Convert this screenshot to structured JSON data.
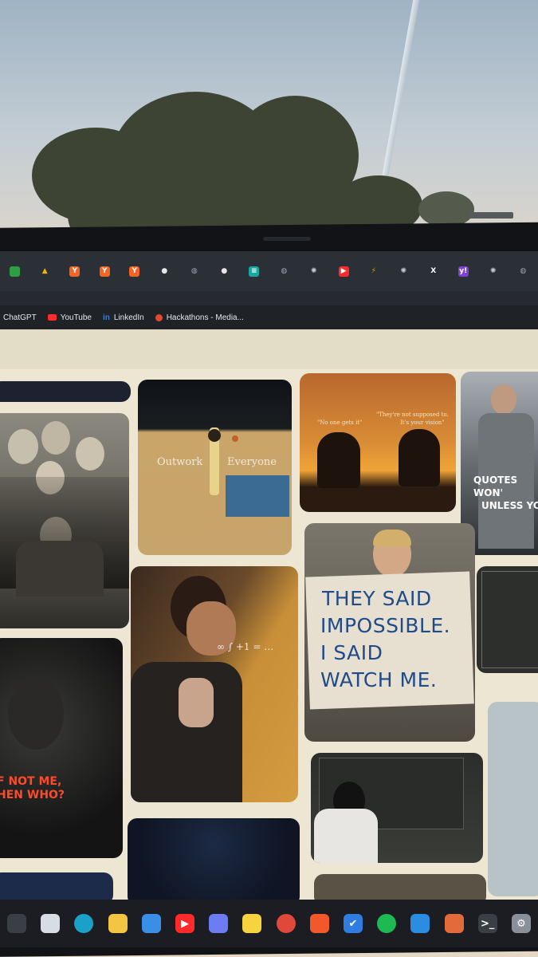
{
  "tabs": [
    {
      "icon": "green-app-icon",
      "label": "",
      "color": "#2ea043"
    },
    {
      "icon": "google-drive-icon",
      "label": "▲",
      "color": "#f4b400"
    },
    {
      "icon": "ycombinator-icon",
      "label": "Y",
      "color": "#f26522"
    },
    {
      "icon": "ycombinator-icon",
      "label": "Y",
      "color": "#f26522"
    },
    {
      "icon": "ycombinator-icon",
      "label": "Y",
      "color": "#f26522"
    },
    {
      "icon": "github-icon",
      "label": "●",
      "color": "#e6e6e6"
    },
    {
      "icon": "globe-icon",
      "label": "◍",
      "color": "#9aa3ad"
    },
    {
      "icon": "github-icon",
      "label": "●",
      "color": "#e6e6e6"
    },
    {
      "icon": "docs-icon",
      "label": "≡",
      "color": "#19a8a0"
    },
    {
      "icon": "globe-icon",
      "label": "◍",
      "color": "#9aa3ad"
    },
    {
      "icon": "openai-icon",
      "label": "✺",
      "color": "#c9ccd0"
    },
    {
      "icon": "youtube-icon",
      "label": "▶",
      "color": "#ff2a2a"
    },
    {
      "icon": "hackathon-icon",
      "label": "⚡",
      "color": "#f59e0b"
    },
    {
      "icon": "openai-icon",
      "label": "✺",
      "color": "#c9ccd0"
    },
    {
      "icon": "x-icon",
      "label": "X",
      "color": "#ffffff"
    },
    {
      "icon": "yahoo-icon",
      "label": "y!",
      "color": "#7e3fd9"
    },
    {
      "icon": "openai-icon",
      "label": "✺",
      "color": "#c9ccd0"
    },
    {
      "icon": "globe-icon",
      "label": "◍",
      "color": "#9aa3ad"
    }
  ],
  "bookmarks": [
    {
      "label": "ChatGPT",
      "color": "#1f2328"
    },
    {
      "label": "YouTube",
      "color": "#ff2a2a"
    },
    {
      "label": "LinkedIn",
      "color": "#3b7bd8"
    },
    {
      "label": "Hackathons - Media...",
      "color": "#e5492b"
    }
  ],
  "pins": {
    "court_left": "Outwork",
    "court_right": "Everyone",
    "sunset_left": "\"No one gets it\"",
    "sunset_right_1": "\"They're not supposed to.",
    "sunset_right_2": "It's your vision\"",
    "quotes_1": "QUOTES WON'",
    "quotes_2": "UNLESS YO",
    "sign_1": "THEY SAID",
    "sign_2": "IMPOSSIBLE.",
    "sign_3": "I SAID",
    "sign_4": "WATCH ME.",
    "whonot_1": "F NOT ME,",
    "whonot_2": "HEN WHO?"
  },
  "taskbar": [
    {
      "icon": "search-icon",
      "label": "",
      "color": "#3a3f46"
    },
    {
      "icon": "task-view-icon",
      "label": "",
      "color": "#d8dde3"
    },
    {
      "icon": "edge-icon",
      "label": "",
      "color": "#1aa0c9"
    },
    {
      "icon": "file-explorer-icon",
      "label": "",
      "color": "#f4c542"
    },
    {
      "icon": "store-icon",
      "label": "",
      "color": "#3a8ee6"
    },
    {
      "icon": "youtube-icon",
      "label": "▶",
      "color": "#ff2a2a"
    },
    {
      "icon": "copilot-icon",
      "label": "",
      "color": "#6c7cf2"
    },
    {
      "icon": "sticky-notes-icon",
      "label": "",
      "color": "#f6d33f"
    },
    {
      "icon": "chrome-icon",
      "label": "",
      "color": "#e0483a"
    },
    {
      "icon": "brave-icon",
      "label": "",
      "color": "#f1582a"
    },
    {
      "icon": "todo-icon",
      "label": "✔",
      "color": "#2f7de1"
    },
    {
      "icon": "spotify-icon",
      "label": "",
      "color": "#1db954"
    },
    {
      "icon": "vscode-icon",
      "label": "",
      "color": "#2a8de1"
    },
    {
      "icon": "record-icon",
      "label": "",
      "color": "#e36a3a"
    },
    {
      "icon": "terminal-icon",
      "label": ">_",
      "color": "#3a3f46"
    },
    {
      "icon": "settings-icon",
      "label": "⚙",
      "color": "#8a9099"
    }
  ]
}
